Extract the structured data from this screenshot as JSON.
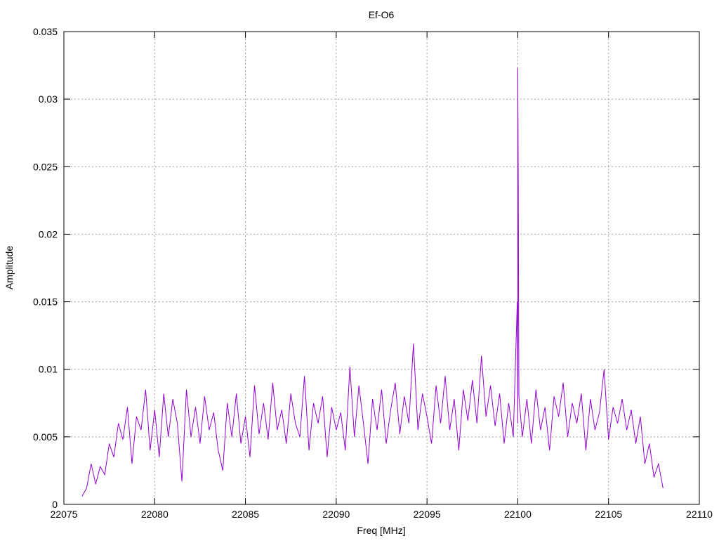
{
  "chart_data": {
    "type": "line",
    "title": "Ef-O6",
    "xlabel": "Freq [MHz]",
    "ylabel": "Amplitude",
    "xlim": [
      22075,
      22110
    ],
    "ylim": [
      0,
      0.035
    ],
    "xticks": [
      "22075",
      "22080",
      "22085",
      "22090",
      "22095",
      "22100",
      "22105",
      "22110"
    ],
    "yticks": [
      "0",
      "0.005",
      "0.01",
      "0.015",
      "0.02",
      "0.025",
      "0.03",
      "0.035"
    ],
    "grid": true,
    "line_color": "#9400d3",
    "series": [
      {
        "name": "Ef-O6",
        "x_start": 22076,
        "x_step": 0.25,
        "values": [
          0.0006,
          0.0012,
          0.003,
          0.0015,
          0.0028,
          0.0022,
          0.0045,
          0.0035,
          0.006,
          0.0048,
          0.0072,
          0.003,
          0.0065,
          0.0055,
          0.0085,
          0.004,
          0.007,
          0.0035,
          0.0082,
          0.005,
          0.0078,
          0.006,
          0.0017,
          0.0085,
          0.005,
          0.0072,
          0.0045,
          0.008,
          0.0055,
          0.0068,
          0.004,
          0.0025,
          0.0075,
          0.005,
          0.0082,
          0.0045,
          0.0065,
          0.0035,
          0.0088,
          0.0052,
          0.0075,
          0.0048,
          0.009,
          0.0055,
          0.007,
          0.0045,
          0.0082,
          0.006,
          0.005,
          0.0095,
          0.004,
          0.0075,
          0.006,
          0.008,
          0.0035,
          0.0072,
          0.0055,
          0.0068,
          0.004,
          0.0102,
          0.005,
          0.0088,
          0.006,
          0.003,
          0.0078,
          0.0055,
          0.0085,
          0.0045,
          0.007,
          0.009,
          0.0052,
          0.008,
          0.006,
          0.0119,
          0.0055,
          0.0082,
          0.0065,
          0.0045,
          0.0088,
          0.006,
          0.0095,
          0.0055,
          0.0078,
          0.004,
          0.0085,
          0.0062,
          0.0092,
          0.006,
          0.011,
          0.0065,
          0.0088,
          0.0058,
          0.0082,
          0.0045,
          0.0075,
          0.005,
          0.006,
          0.005,
          0.0078,
          0.0045,
          0.0085,
          0.0055,
          0.0072,
          0.004,
          0.008,
          0.0065,
          0.009,
          0.005,
          0.0075,
          0.006,
          0.0082,
          0.004,
          0.0078,
          0.0055,
          0.0068,
          0.01,
          0.0048,
          0.0072,
          0.006,
          0.0078,
          0.0055,
          0.007,
          0.0045,
          0.0065,
          0.003,
          0.0045,
          0.002,
          0.003,
          0.0012
        ],
        "peaks": [
          [
            22099.97,
            0.015
          ],
          [
            22100.0,
            0.0323
          ],
          [
            22100.03,
            0.0231
          ],
          [
            22100.06,
            0.008
          ]
        ]
      }
    ]
  }
}
